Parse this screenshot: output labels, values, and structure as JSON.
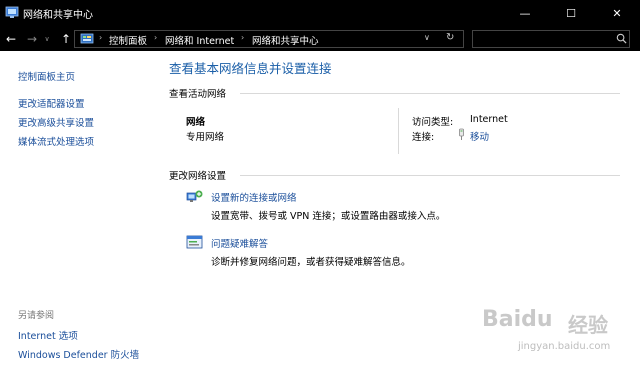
{
  "window": {
    "title": "网络和共享中心",
    "minimize_glyph": "—",
    "maximize_glyph": "☐",
    "close_glyph": "✕"
  },
  "navbar": {
    "back_glyph": "←",
    "forward_glyph": "→",
    "history_glyph": "∨",
    "up_glyph": "↑",
    "breadcrumbs": [
      "控制面板",
      "网络和 Internet",
      "网络和共享中心"
    ],
    "separator_glyph": "›",
    "dropdown_glyph": "∨",
    "refresh_glyph": "↻",
    "search_placeholder": ""
  },
  "sidebar": {
    "home": "控制面板主页",
    "items": [
      "更改适配器设置",
      "更改高级共享设置",
      "媒体流式处理选项"
    ],
    "see_also_title": "另请参阅",
    "see_also_items": [
      "Internet 选项",
      "Windows Defender 防火墙"
    ]
  },
  "main": {
    "title": "查看基本网络信息并设置连接",
    "active_networks_heading": "查看活动网络",
    "network": {
      "name": "网络",
      "type": "专用网络",
      "access_type_label": "访问类型:",
      "access_type_value": "Internet",
      "connections_label": "连接:",
      "connection_name": "移动"
    },
    "change_settings_heading": "更改网络设置",
    "tasks": [
      {
        "title": "设置新的连接或网络",
        "desc": "设置宽带、拨号或 VPN 连接；或设置路由器或接入点。"
      },
      {
        "title": "问题疑难解答",
        "desc": "诊断并修复网络问题，或者获得疑难解答信息。"
      }
    ]
  },
  "watermark": {
    "brand": "Baidu",
    "cn": "经验",
    "url": "jingyan.baidu.com"
  },
  "colors": {
    "titlebar": "#000000",
    "link": "#1a4e9a",
    "title_blue": "#1b5fa8",
    "divider": "#d9d9d9"
  }
}
